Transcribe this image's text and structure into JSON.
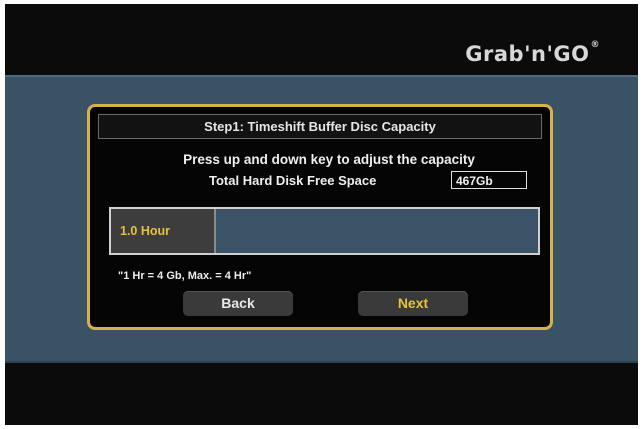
{
  "brand": {
    "logo_text": "Grab'n'GO",
    "registered_mark": "®"
  },
  "dialog": {
    "title": "Step1: Timeshift Buffer Disc Capacity",
    "instruction": "Press up and down key to adjust the capacity",
    "free_space_label": "Total Hard Disk Free Space",
    "free_space_value": "467Gb",
    "capacity": {
      "label": "1.0 Hour",
      "value_hours": 1.0,
      "max_hours": 4
    },
    "note": "\"1 Hr = 4 Gb, Max. = 4 Hr\"",
    "buttons": {
      "back": "Back",
      "next": "Next"
    }
  },
  "colors": {
    "accent_gold": "#d8b14a",
    "band_blue": "#3a5364",
    "highlight_text": "#e5c23b"
  }
}
